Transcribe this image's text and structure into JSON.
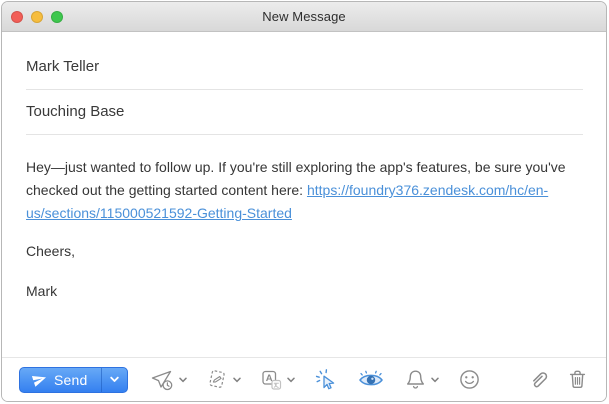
{
  "window": {
    "title": "New Message"
  },
  "titlebar": {
    "traffic_light_colors": {
      "close": "#f25e57",
      "minimize": "#f6bd3e",
      "zoom": "#3ec74e"
    }
  },
  "fields": {
    "to": "Mark Teller",
    "subject": "Touching Base"
  },
  "body": {
    "intro": "Hey—just wanted to follow up. If you're still exploring the app's features, be sure you've checked out the getting started content here: ",
    "link": "https://foundry376.zendesk.com/hc/en-us/sections/115000521592-Getting-Started",
    "closing": "Cheers,",
    "signature": "Mark"
  },
  "toolbar": {
    "send": {
      "label": "Send"
    },
    "icons": [
      {
        "name": "send-icon",
        "glyph": "paper-plane",
        "color": "#ffffff"
      },
      {
        "name": "send-later-icon",
        "glyph": "paper-plane-clock",
        "has_dropdown": true,
        "color": "#8b8b8b"
      },
      {
        "name": "template-icon",
        "glyph": "dashed-note-pencil",
        "has_dropdown": true,
        "color": "#8b8b8b"
      },
      {
        "name": "translate-icon",
        "glyph": "letter-a-boxes",
        "has_dropdown": true,
        "color": "#8b8b8b"
      },
      {
        "name": "link-tracking-icon",
        "glyph": "cursor-click-rays",
        "active": true,
        "color": "#4a90d9"
      },
      {
        "name": "open-tracking-icon",
        "glyph": "eye",
        "active": true,
        "color": "#4a90d9"
      },
      {
        "name": "reminder-bell-icon",
        "glyph": "bell",
        "has_dropdown": true,
        "color": "#8b8b8b"
      },
      {
        "name": "emoji-icon",
        "glyph": "smiley-face",
        "color": "#8b8b8b"
      },
      {
        "name": "attachment-icon",
        "glyph": "paperclip",
        "color": "#8b8b8b"
      },
      {
        "name": "trash-icon",
        "glyph": "trash-can",
        "color": "#8b8b8b"
      }
    ]
  },
  "colors": {
    "accent_blue": "#3b82ee",
    "link_blue": "#4a90d9",
    "icon_gray": "#8b8b8b",
    "divider": "#e4e4e4",
    "titlebar_top": "#ececec",
    "titlebar_bottom": "#d8d8d8"
  }
}
